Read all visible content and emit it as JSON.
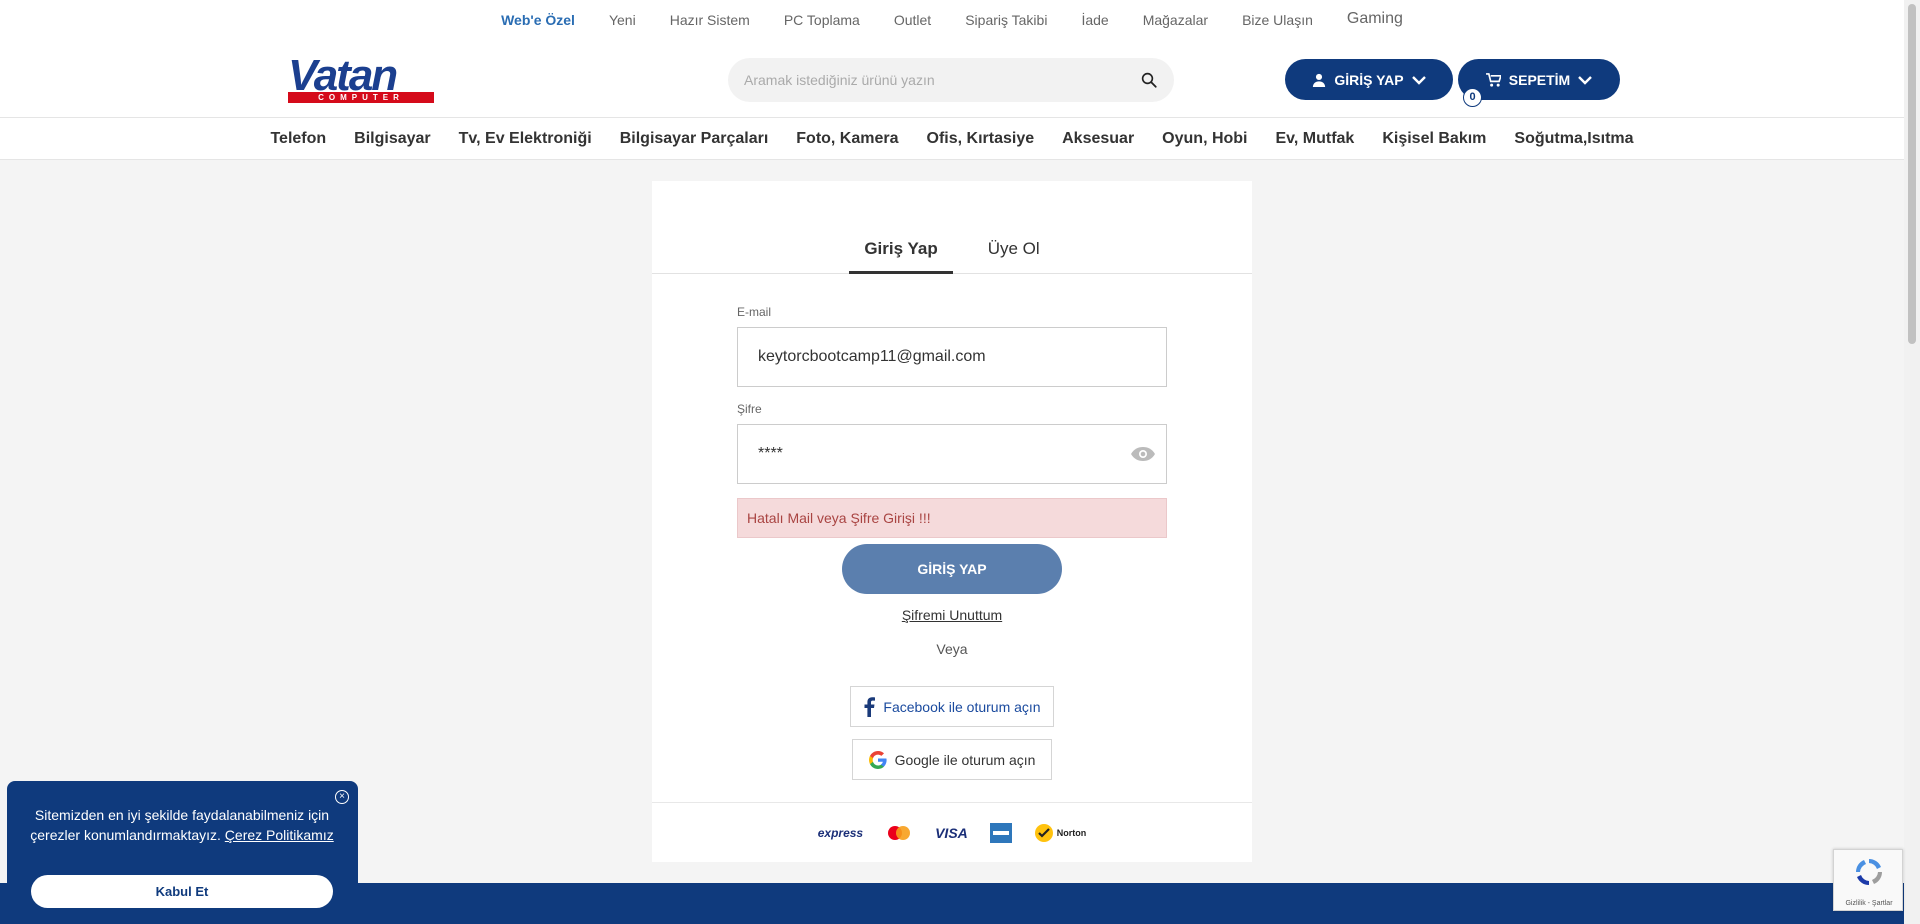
{
  "top_links": [
    "Web'e Özel",
    "Yeni",
    "Hazır Sistem",
    "PC Toplama",
    "Outlet",
    "Sipariş Takibi",
    "İade",
    "Mağazalar",
    "Bize Ulaşın",
    "Gaming"
  ],
  "logo": {
    "word": "Vatan",
    "sub": "COMPUTER"
  },
  "search": {
    "placeholder": "Aramak istediğiniz ürünü yazın"
  },
  "header": {
    "login_label": "GİRİŞ YAP",
    "cart_label": "SEPETİM",
    "cart_count": "0"
  },
  "categories": [
    "Telefon",
    "Bilgisayar",
    "Tv, Ev Elektroniği",
    "Bilgisayar Parçaları",
    "Foto, Kamera",
    "Ofis, Kırtasiye",
    "Aksesuar",
    "Oyun, Hobi",
    "Ev, Mutfak",
    "Kişisel Bakım",
    "Soğutma,Isıtma"
  ],
  "tabs": {
    "login": "Giriş Yap",
    "register": "Üye Ol"
  },
  "form": {
    "email_label": "E-mail",
    "email_value": "keytorcbootcamp11@gmail.com",
    "password_label": "Şifre",
    "password_value": "****",
    "error": "Hatalı Mail veya Şifre Girişi !!!",
    "submit": "GİRİŞ YAP",
    "forgot": "Şifremi Unuttum",
    "or": "Veya",
    "facebook": "Facebook ile oturum açın",
    "google": "Google ile oturum açın"
  },
  "payment_marks": [
    "express",
    "VISA",
    "Norton"
  ],
  "cookie": {
    "message": "Sitemizden en iyi şekilde faydalanabilmeniz için çerezler konumlandırmaktayız.",
    "link": "Çerez Politikamız",
    "accept": "Kabul Et",
    "close": "×"
  },
  "recaptcha": {
    "text": "Gizlilik - Şartlar"
  },
  "colors": {
    "primary": "#0f3a7d",
    "submit": "#5b7fae",
    "error_bg": "#f5dadb",
    "error_text": "#a94442",
    "brand_red": "#d50a1a"
  }
}
